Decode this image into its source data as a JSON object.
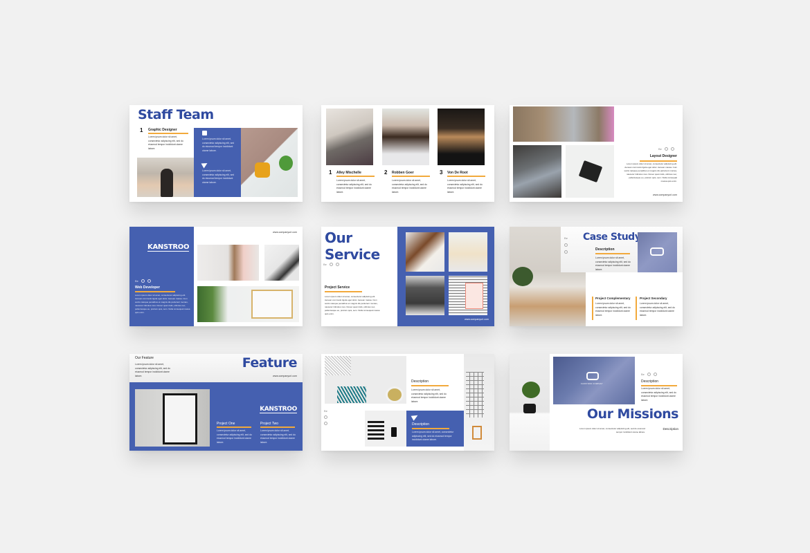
{
  "colors": {
    "background": "#f1f1f1",
    "brand_blue": "#4560b0",
    "title_blue": "#2f4aa0",
    "accent_orange": "#f2a93b"
  },
  "lorem_short": "Lorem ipsum dolor sit amet, consectetur adipiscing elit, sed do eiusmod tempor incididunt utame labore.",
  "lorem_long": "Lorem ipsum dolor sit amet, consectetur adipiscing elit. Aenean commodo ligula eget dolor. Aenean massa. Cum sociis natoque penatibus et magnis dis parturient montes, nascetur ridiculus mus. Donec quam felis, ultricies nec, pellentesque eu, pretium quis, sem. Nulla consequat massa quis enim.",
  "lorem_medium": "Lorem ipsum dolor sit amet, consectetur adipiscing elit, sed do eiusmod tempor incididunt utame labore.",
  "social": {
    "behance": "Be"
  },
  "slides": [
    {
      "title": "Staff Team",
      "number": "1",
      "role": "Graphic Designer",
      "icons": [
        "chat-icon",
        "send-icon"
      ]
    },
    {
      "members": [
        {
          "number": "1",
          "name": "Alley Mischelle"
        },
        {
          "number": "2",
          "name": "Robben Goer"
        },
        {
          "number": "3",
          "name": "Von De Root"
        }
      ]
    },
    {
      "role": "Layout Designer",
      "url": "www.companyurl.com"
    },
    {
      "logo": "KANSTROO",
      "role": "Web Developer",
      "url": "www.companyurl.com"
    },
    {
      "title_line1": "Our",
      "title_line2": "Service",
      "label": "Project Service",
      "url": "www.companyurl.com"
    },
    {
      "title": "Case Study",
      "description_label": "Description",
      "project_a": "Project Complementary",
      "project_b": "Project Secondary"
    },
    {
      "eyebrow": "Our Feature",
      "title": "Feature",
      "url": "www.companyurl.com",
      "logo": "KANSTROO",
      "project_a": "Project One",
      "project_b": "Project Two"
    },
    {
      "description_top": "Description",
      "description_bottom": "Description"
    },
    {
      "title": "Our Missions",
      "description_label": "Description",
      "description_right": "Description",
      "logo": "KANSTROO COMPANY"
    }
  ]
}
